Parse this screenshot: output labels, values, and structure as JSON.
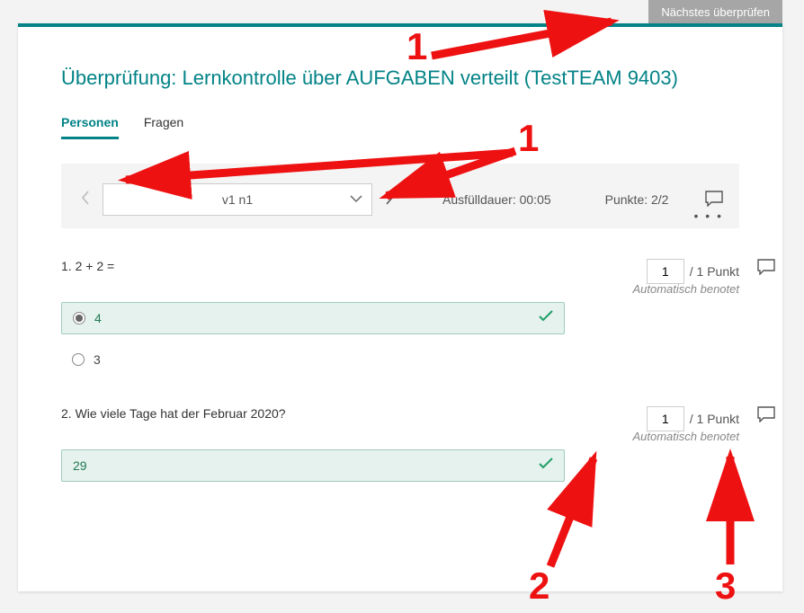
{
  "topButton": "Nächstes überprüfen",
  "title": "Überprüfung: Lernkontrolle über AUFGABEN verteilt (TestTEAM 9403)",
  "tabs": {
    "people": "Personen",
    "questions": "Fragen"
  },
  "summary": {
    "person": "v1 n1",
    "durationLabel": "Ausfülldauer: 00:05",
    "pointsLabel": "Punkte: 2/2"
  },
  "questions": [
    {
      "number": "1.",
      "text": "2 + 2 =",
      "score": "1",
      "scoreMax": "/ 1 Punkt",
      "autoGraded": "Automatisch benotet",
      "options": [
        {
          "label": "4",
          "selected": true,
          "correct": true
        },
        {
          "label": "3",
          "selected": false,
          "correct": false
        }
      ]
    },
    {
      "number": "2.",
      "text": "Wie viele Tage hat der Februar 2020?",
      "score": "1",
      "scoreMax": "/ 1 Punkt",
      "autoGraded": "Automatisch benotet",
      "answerText": "29"
    }
  ],
  "annotations": {
    "a1a": "1",
    "a1b": "1",
    "a2": "2",
    "a3": "3"
  }
}
